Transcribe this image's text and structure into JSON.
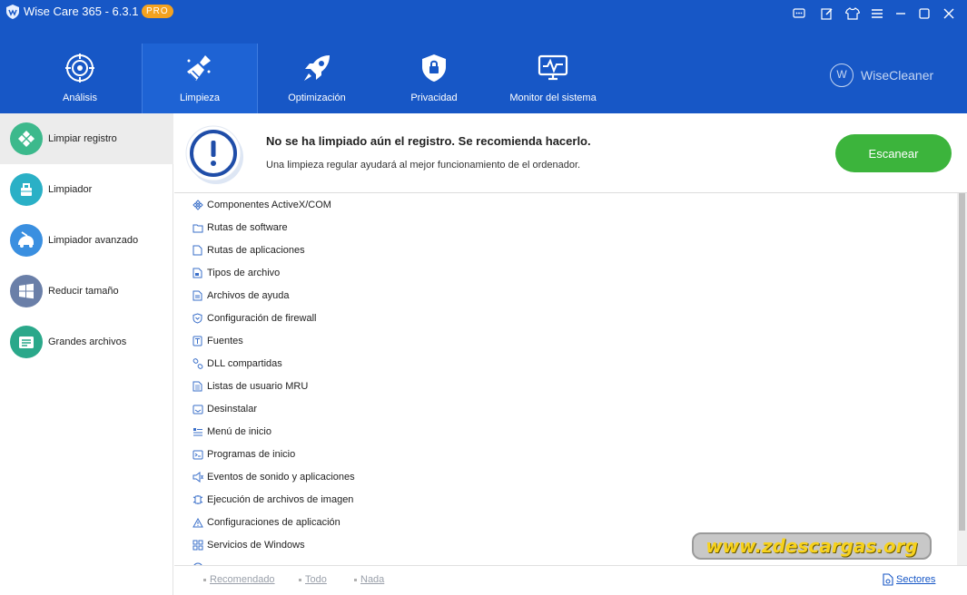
{
  "app": {
    "title": "Wise Care 365 - 6.3.1",
    "badge": "PRO",
    "brand": "WiseCleaner",
    "brand_mark": "W",
    "accent_color": "#1757c6"
  },
  "window_controls": [
    "feedback-icon",
    "edit-icon",
    "skin-icon",
    "menu-icon",
    "minimize-icon",
    "maximize-icon",
    "close-icon"
  ],
  "nav": [
    {
      "label": "Análisis",
      "icon": "target-icon",
      "active": false
    },
    {
      "label": "Limpieza",
      "icon": "broom-icon",
      "active": true
    },
    {
      "label": "Optimización",
      "icon": "rocket-icon",
      "active": false
    },
    {
      "label": "Privacidad",
      "icon": "shield-lock-icon",
      "active": false
    },
    {
      "label": "Monitor del sistema",
      "icon": "monitor-icon",
      "active": false
    }
  ],
  "sidebar": [
    {
      "label": "Limpiar registro",
      "icon": "registry-icon",
      "color": "#3cb98c",
      "active": true
    },
    {
      "label": "Limpiador",
      "icon": "cleaner-icon",
      "color": "#2ab0c6",
      "active": false
    },
    {
      "label": "Limpiador avanzado",
      "icon": "vacuum-icon",
      "color": "#3a8fe0",
      "active": false
    },
    {
      "label": "Reducir tamaño",
      "icon": "windows-icon",
      "color": "#6a7fa8",
      "active": false
    },
    {
      "label": "Grandes archivos",
      "icon": "files-icon",
      "color": "#2aa88a",
      "active": false
    }
  ],
  "banner": {
    "title": "No se ha limpiado aún el registro. Se recomienda hacerlo.",
    "subtitle": "Una limpieza regular ayudará al mejor funcionamiento de el ordenador.",
    "scan_button": "Escanear"
  },
  "list": [
    {
      "label": "Componentes ActiveX/COM",
      "icon": "activex-icon"
    },
    {
      "label": "Rutas de software",
      "icon": "folder-icon"
    },
    {
      "label": "Rutas de aplicaciones",
      "icon": "file-icon"
    },
    {
      "label": "Tipos de archivo",
      "icon": "file-type-icon"
    },
    {
      "label": "Archivos de ayuda",
      "icon": "help-file-icon"
    },
    {
      "label": "Configuración de firewall",
      "icon": "firewall-icon"
    },
    {
      "label": "Fuentes",
      "icon": "font-icon"
    },
    {
      "label": "DLL compartidas",
      "icon": "dll-icon"
    },
    {
      "label": "Listas de usuario MRU",
      "icon": "list-icon"
    },
    {
      "label": "Desinstalar",
      "icon": "uninstall-icon"
    },
    {
      "label": "Menú de inicio",
      "icon": "start-menu-icon"
    },
    {
      "label": "Programas de inicio",
      "icon": "startup-icon"
    },
    {
      "label": "Eventos de sonido y aplicaciones",
      "icon": "sound-icon"
    },
    {
      "label": "Ejecución de archivos de imagen",
      "icon": "image-exec-icon"
    },
    {
      "label": "Configuraciones de aplicación",
      "icon": "warning-icon"
    },
    {
      "label": "Servicios de Windows",
      "icon": "services-icon"
    },
    {
      "label": "",
      "icon": "cache-icon"
    }
  ],
  "footer": {
    "recommended": "Recomendado",
    "all": "Todo",
    "none": "Nada",
    "sectors": "Sectores"
  },
  "watermark": "www.zdescargas.org"
}
